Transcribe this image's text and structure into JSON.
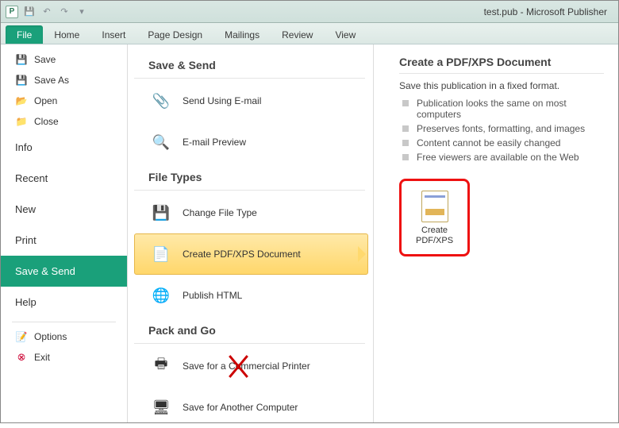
{
  "titlebar": {
    "app_letter": "P",
    "title": "test.pub  -  Microsoft Publisher"
  },
  "ribbon": {
    "tabs": [
      "File",
      "Home",
      "Insert",
      "Page Design",
      "Mailings",
      "Review",
      "View"
    ]
  },
  "nav": {
    "save": "Save",
    "save_as": "Save As",
    "open": "Open",
    "close": "Close",
    "info": "Info",
    "recent": "Recent",
    "new": "New",
    "print": "Print",
    "save_send": "Save & Send",
    "help": "Help",
    "options": "Options",
    "exit": "Exit"
  },
  "middle": {
    "sec_save_send": "Save & Send",
    "send_email": "Send Using E-mail",
    "email_preview": "E-mail Preview",
    "sec_file_types": "File Types",
    "change_file_type": "Change File Type",
    "create_pdf_xps": "Create PDF/XPS Document",
    "publish_html": "Publish HTML",
    "sec_pack_go": "Pack and Go",
    "save_commercial": "Save for a Commercial Printer",
    "save_another": "Save for Another Computer"
  },
  "right": {
    "heading": "Create a PDF/XPS Document",
    "desc": "Save this publication in a fixed format.",
    "bullets": [
      "Publication looks the same on most computers",
      "Preserves fonts, formatting, and images",
      "Content cannot be easily changed",
      "Free viewers are available on the Web"
    ],
    "action_line1": "Create",
    "action_line2": "PDF/XPS"
  }
}
